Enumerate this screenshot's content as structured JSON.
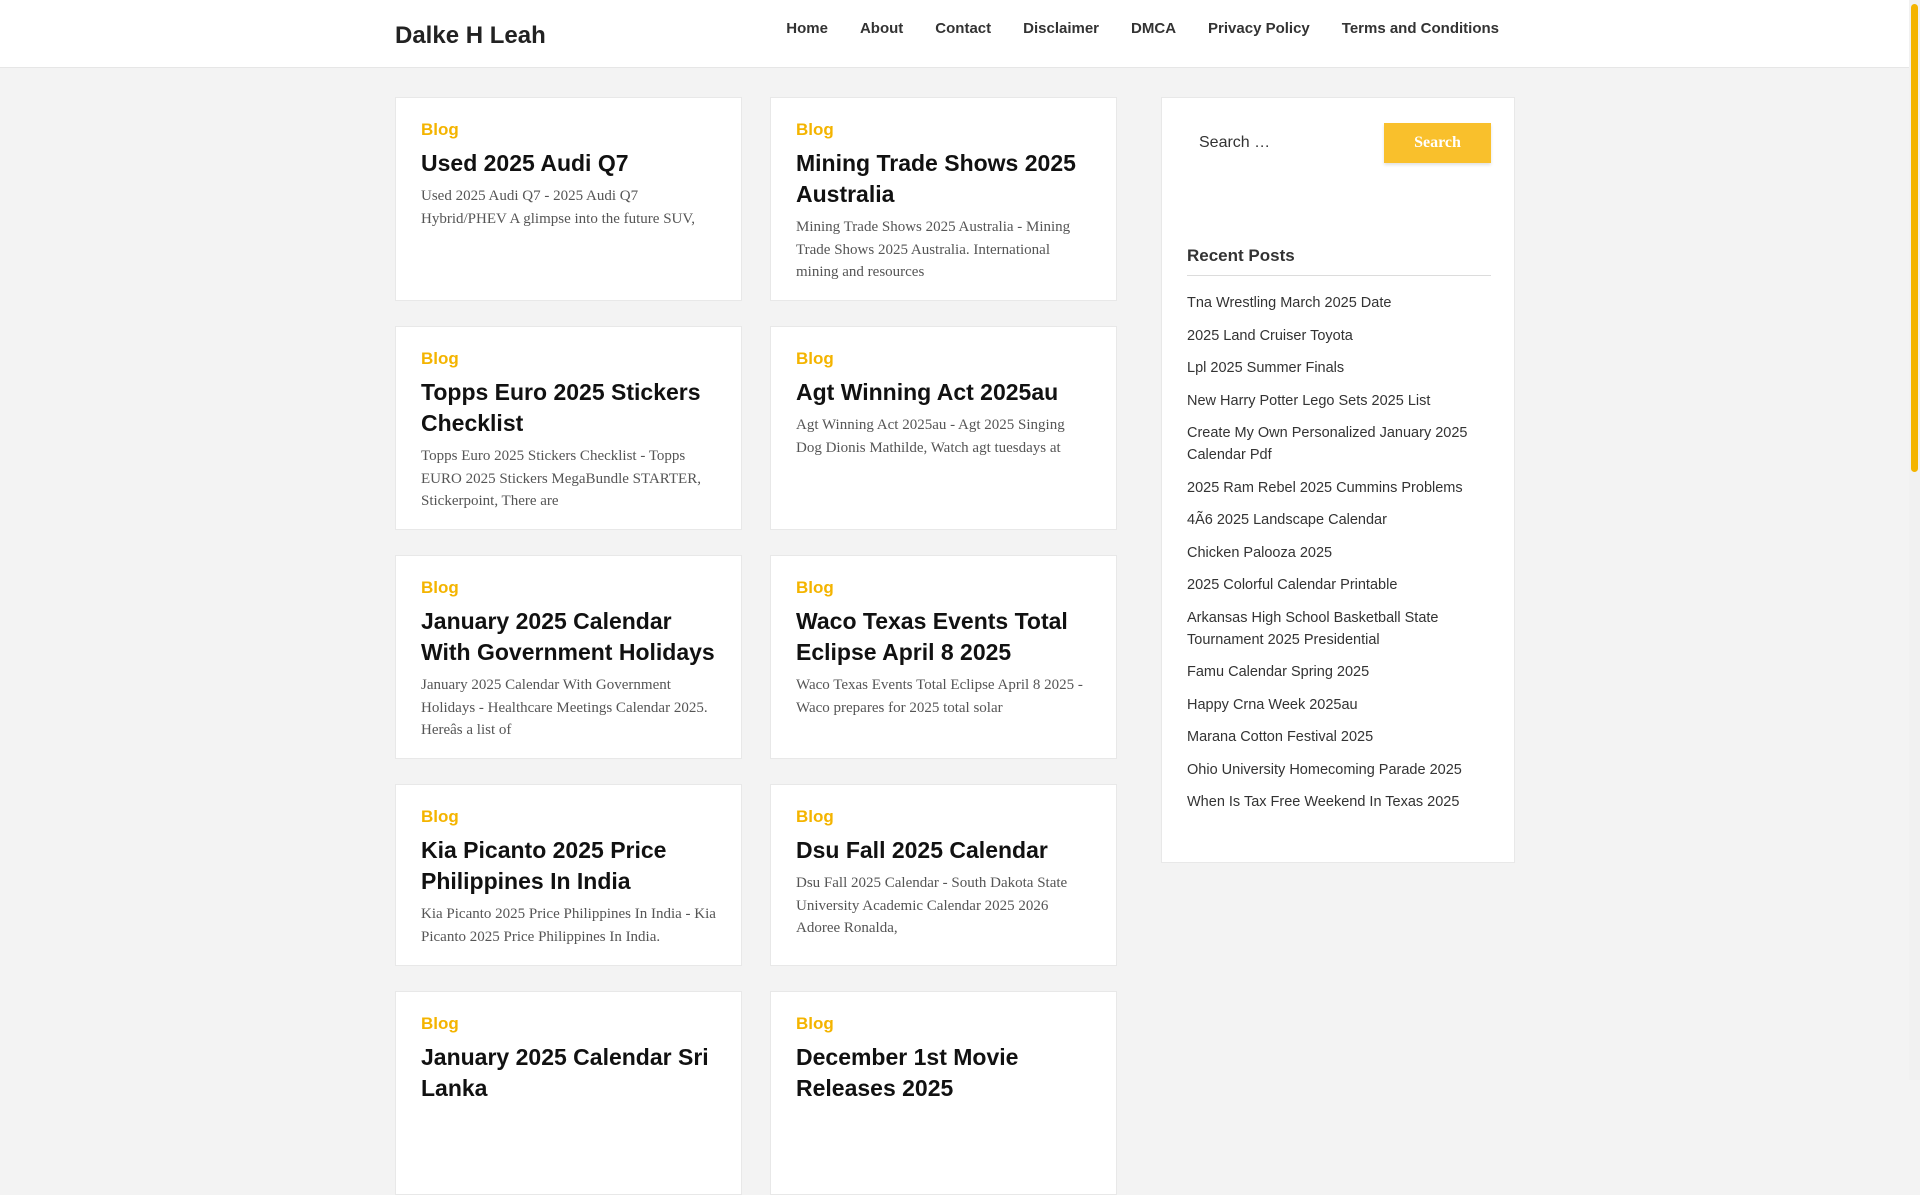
{
  "site": {
    "title": "Dalke H Leah"
  },
  "nav": [
    "Home",
    "About",
    "Contact",
    "Disclaimer",
    "DMCA",
    "Privacy Policy",
    "Terms and Conditions"
  ],
  "posts": [
    {
      "category": "Blog",
      "title": "Used 2025 Audi Q7",
      "excerpt": "Used 2025 Audi Q7 - 2025 Audi Q7 Hybrid/PHEV A glimpse into the future SUV,"
    },
    {
      "category": "Blog",
      "title": "Mining Trade Shows 2025 Australia",
      "excerpt": "Mining Trade Shows 2025 Australia - Mining Trade Shows 2025 Australia. International mining and resources"
    },
    {
      "category": "Blog",
      "title": "Topps Euro 2025 Stickers Checklist",
      "excerpt": "Topps Euro 2025 Stickers Checklist - Topps EURO 2025 Stickers MegaBundle STARTER, Stickerpoint, There are"
    },
    {
      "category": "Blog",
      "title": "Agt Winning Act 2025au",
      "excerpt": "Agt Winning Act 2025au - Agt 2025 Singing Dog Dionis Mathilde, Watch agt tuesdays at"
    },
    {
      "category": "Blog",
      "title": "January 2025 Calendar With Government Holidays",
      "excerpt": "January 2025 Calendar With Government Holidays - Healthcare Meetings Calendar 2025. Hereâs a list of"
    },
    {
      "category": "Blog",
      "title": "Waco Texas Events Total Eclipse April 8 2025",
      "excerpt": "Waco Texas Events Total Eclipse April 8 2025 - Waco prepares for 2025 total solar"
    },
    {
      "category": "Blog",
      "title": "Kia Picanto 2025 Price Philippines In India",
      "excerpt": "Kia Picanto 2025 Price Philippines In India - Kia Picanto 2025 Price Philippines In India."
    },
    {
      "category": "Blog",
      "title": "Dsu Fall 2025 Calendar",
      "excerpt": "Dsu Fall 2025 Calendar - South Dakota State University Academic Calendar 2025 2026 Adoree Ronalda,"
    },
    {
      "category": "Blog",
      "title": "January 2025 Calendar Sri Lanka",
      "excerpt": ""
    },
    {
      "category": "Blog",
      "title": "December 1st Movie Releases 2025",
      "excerpt": ""
    }
  ],
  "sidebar": {
    "search_placeholder": "Search …",
    "search_button": "Search",
    "recent_title": "Recent Posts",
    "recent_posts": [
      "Tna Wrestling March 2025 Date",
      "2025 Land Cruiser Toyota",
      "Lpl 2025 Summer Finals",
      "New Harry Potter Lego Sets 2025 List",
      "Create My Own Personalized January 2025 Calendar Pdf",
      "2025 Ram Rebel 2025 Cummins Problems",
      "4Ã6 2025 Landscape Calendar",
      "Chicken Palooza 2025",
      "2025 Colorful Calendar Printable",
      "Arkansas High School Basketball State Tournament 2025 Presidential",
      "Famu Calendar Spring 2025",
      "Happy Crna Week 2025au",
      "Marana Cotton Festival 2025",
      "Ohio University Homecoming Parade 2025",
      "When Is Tax Free Weekend In Texas 2025"
    ]
  },
  "colors": {
    "accent": "#f4b400",
    "button": "#f9c02c",
    "background": "#f3f3f3"
  }
}
